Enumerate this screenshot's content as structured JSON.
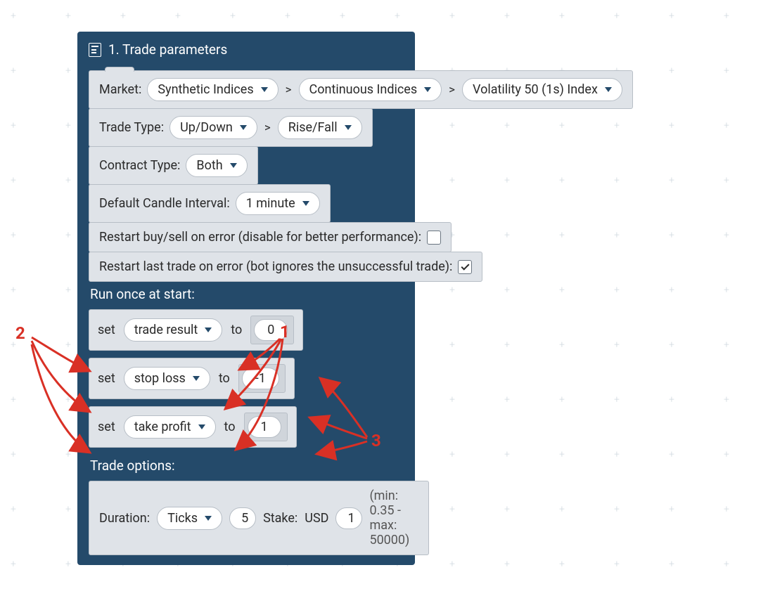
{
  "header": {
    "title": "1. Trade parameters"
  },
  "market": {
    "label": "Market:",
    "level1": "Synthetic Indices",
    "level2": "Continuous Indices",
    "level3": "Volatility 50 (1s) Index"
  },
  "trade_type": {
    "label": "Trade Type:",
    "level1": "Up/Down",
    "level2": "Rise/Fall"
  },
  "contract_type": {
    "label": "Contract Type:",
    "value": "Both"
  },
  "candle_interval": {
    "label": "Default Candle Interval:",
    "value": "1 minute"
  },
  "restart_error": {
    "label": "Restart buy/sell on error (disable for better performance):",
    "checked": false
  },
  "restart_last": {
    "label": "Restart last trade on error (bot ignores the unsuccessful trade):",
    "checked": true
  },
  "run_once": {
    "label": "Run once at start:"
  },
  "vars": [
    {
      "set": "set",
      "name": "trade result",
      "to": "to",
      "value": "0"
    },
    {
      "set": "set",
      "name": "stop loss",
      "to": "to",
      "value": "-1"
    },
    {
      "set": "set",
      "name": "take profit",
      "to": "to",
      "value": "1"
    }
  ],
  "trade_options": {
    "label": "Trade options:",
    "duration_label": "Duration:",
    "duration_unit": "Ticks",
    "duration_value": "5",
    "stake_label": "Stake:",
    "currency": "USD",
    "stake_value": "1",
    "limits": "(min: 0.35 - max: 50000)"
  },
  "annotations": {
    "one": "1",
    "two": "2",
    "three": "3"
  }
}
